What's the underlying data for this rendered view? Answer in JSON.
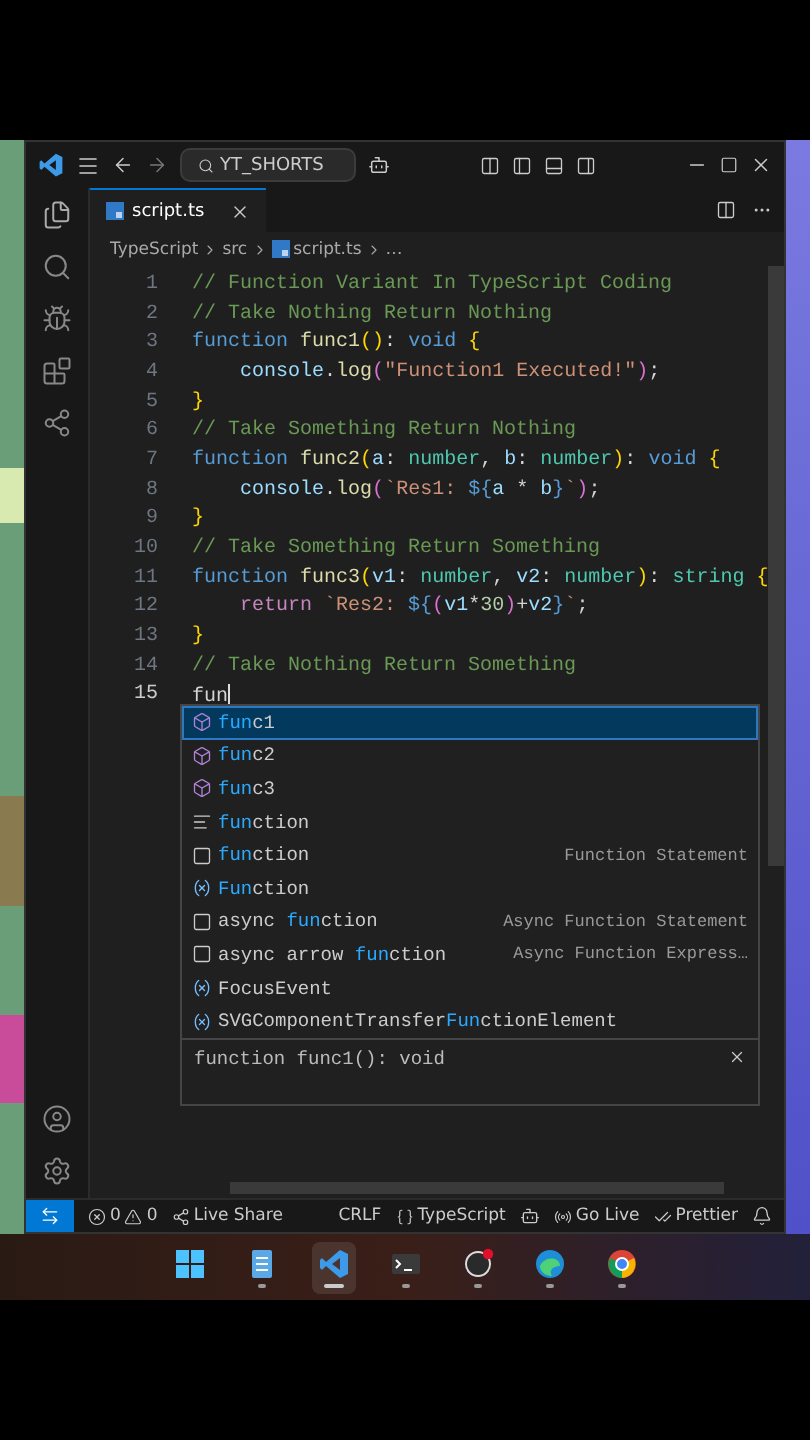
{
  "title_bar": {
    "search": "YT_SHORTS"
  },
  "tabs": [
    {
      "label": "script.ts",
      "selected": true
    }
  ],
  "breadcrumb": [
    "TypeScript",
    "src",
    "script.ts",
    "…"
  ],
  "code_lines": [
    {
      "number": "1",
      "indented": false,
      "current": false,
      "tokens": [
        {
          "kind": "comment",
          "text": "// Function Variant In TypeScript Coding"
        }
      ]
    },
    {
      "number": "2",
      "indented": false,
      "current": false,
      "tokens": [
        {
          "kind": "comment",
          "text": "// Take Nothing Return Nothing"
        }
      ]
    },
    {
      "number": "3",
      "indented": false,
      "current": false,
      "tokens": [
        {
          "kind": "keyword",
          "text": "function "
        },
        {
          "kind": "fn",
          "text": "func1"
        },
        {
          "kind": "brace",
          "text": "()"
        },
        {
          "kind": "plain",
          "text": ": "
        },
        {
          "kind": "keyword",
          "text": "void "
        },
        {
          "kind": "brace",
          "text": "{"
        }
      ]
    },
    {
      "number": "4",
      "indented": true,
      "current": false,
      "tokens": [
        {
          "kind": "param",
          "text": "console"
        },
        {
          "kind": "plain",
          "text": "."
        },
        {
          "kind": "fn",
          "text": "log"
        },
        {
          "kind": "bracket",
          "text": "("
        },
        {
          "kind": "string",
          "text": "\"Function1 Executed!\""
        },
        {
          "kind": "bracket",
          "text": ")"
        },
        {
          "kind": "plain",
          "text": ";"
        }
      ]
    },
    {
      "number": "5",
      "indented": false,
      "current": false,
      "tokens": [
        {
          "kind": "brace",
          "text": "}"
        }
      ]
    },
    {
      "number": "6",
      "indented": false,
      "current": false,
      "tokens": [
        {
          "kind": "comment",
          "text": "// Take Something Return Nothing"
        }
      ]
    },
    {
      "number": "7",
      "indented": false,
      "current": false,
      "tokens": [
        {
          "kind": "keyword",
          "text": "function "
        },
        {
          "kind": "fn",
          "text": "func2"
        },
        {
          "kind": "brace",
          "text": "("
        },
        {
          "kind": "param",
          "text": "a"
        },
        {
          "kind": "plain",
          "text": ": "
        },
        {
          "kind": "type",
          "text": "number"
        },
        {
          "kind": "plain",
          "text": ", "
        },
        {
          "kind": "param",
          "text": "b"
        },
        {
          "kind": "plain",
          "text": ": "
        },
        {
          "kind": "type",
          "text": "number"
        },
        {
          "kind": "brace",
          "text": ")"
        },
        {
          "kind": "plain",
          "text": ": "
        },
        {
          "kind": "keyword",
          "text": "void "
        },
        {
          "kind": "brace",
          "text": "{"
        }
      ]
    },
    {
      "number": "8",
      "indented": true,
      "current": false,
      "tokens": [
        {
          "kind": "param",
          "text": "console"
        },
        {
          "kind": "plain",
          "text": "."
        },
        {
          "kind": "fn",
          "text": "log"
        },
        {
          "kind": "bracket",
          "text": "("
        },
        {
          "kind": "string",
          "text": "`Res1: "
        },
        {
          "kind": "keyword",
          "text": "${"
        },
        {
          "kind": "param",
          "text": "a"
        },
        {
          "kind": "plain",
          "text": " * "
        },
        {
          "kind": "param",
          "text": "b"
        },
        {
          "kind": "keyword",
          "text": "}"
        },
        {
          "kind": "string",
          "text": "`"
        },
        {
          "kind": "bracket",
          "text": ")"
        },
        {
          "kind": "plain",
          "text": ";"
        }
      ]
    },
    {
      "number": "9",
      "indented": false,
      "current": false,
      "tokens": [
        {
          "kind": "brace",
          "text": "}"
        }
      ]
    },
    {
      "number": "10",
      "indented": false,
      "current": false,
      "tokens": [
        {
          "kind": "comment",
          "text": "// Take Something Return Something"
        }
      ]
    },
    {
      "number": "11",
      "indented": false,
      "current": false,
      "tokens": [
        {
          "kind": "keyword",
          "text": "function "
        },
        {
          "kind": "fn",
          "text": "func3"
        },
        {
          "kind": "brace",
          "text": "("
        },
        {
          "kind": "param",
          "text": "v1"
        },
        {
          "kind": "plain",
          "text": ": "
        },
        {
          "kind": "type",
          "text": "number"
        },
        {
          "kind": "plain",
          "text": ", "
        },
        {
          "kind": "param",
          "text": "v2"
        },
        {
          "kind": "plain",
          "text": ": "
        },
        {
          "kind": "type",
          "text": "number"
        },
        {
          "kind": "brace",
          "text": ")"
        },
        {
          "kind": "plain",
          "text": ": "
        },
        {
          "kind": "type",
          "text": "string "
        },
        {
          "kind": "brace",
          "text": "{"
        }
      ]
    },
    {
      "number": "12",
      "indented": true,
      "current": false,
      "tokens": [
        {
          "kind": "control",
          "text": "return "
        },
        {
          "kind": "string",
          "text": "`Res2: "
        },
        {
          "kind": "keyword",
          "text": "${"
        },
        {
          "kind": "bracket",
          "text": "("
        },
        {
          "kind": "param",
          "text": "v1"
        },
        {
          "kind": "plain",
          "text": "*"
        },
        {
          "kind": "number",
          "text": "30"
        },
        {
          "kind": "bracket",
          "text": ")"
        },
        {
          "kind": "plain",
          "text": "+"
        },
        {
          "kind": "param",
          "text": "v2"
        },
        {
          "kind": "keyword",
          "text": "}"
        },
        {
          "kind": "string",
          "text": "`"
        },
        {
          "kind": "plain",
          "text": ";"
        }
      ]
    },
    {
      "number": "13",
      "indented": false,
      "current": false,
      "tokens": [
        {
          "kind": "brace",
          "text": "}"
        }
      ]
    },
    {
      "number": "14",
      "indented": false,
      "current": false,
      "tokens": [
        {
          "kind": "comment",
          "text": "// Take Nothing Return Something"
        }
      ]
    },
    {
      "number": "15",
      "indented": false,
      "current": true,
      "tokens": [
        {
          "kind": "plain",
          "text": "fun"
        }
      ]
    }
  ],
  "suggestions": {
    "items": [
      {
        "kind": "method",
        "selected": true,
        "parts": [
          {
            "text": "fun",
            "match": true
          },
          {
            "text": "c1",
            "match": false
          }
        ]
      },
      {
        "kind": "method",
        "selected": false,
        "parts": [
          {
            "text": "fun",
            "match": true
          },
          {
            "text": "c2",
            "match": false
          }
        ]
      },
      {
        "kind": "method",
        "selected": false,
        "parts": [
          {
            "text": "fun",
            "match": true
          },
          {
            "text": "c3",
            "match": false
          }
        ]
      },
      {
        "kind": "keyword",
        "selected": false,
        "parts": [
          {
            "text": "fun",
            "match": true
          },
          {
            "text": "ction",
            "match": false
          }
        ]
      },
      {
        "kind": "snippet",
        "selected": false,
        "parts": [
          {
            "text": "fun",
            "match": true
          },
          {
            "text": "ction",
            "match": false
          }
        ],
        "detail": "Function Statement"
      },
      {
        "kind": "variable",
        "selected": false,
        "parts": [
          {
            "text": "Fun",
            "match": true
          },
          {
            "text": "ction",
            "match": false
          }
        ]
      },
      {
        "kind": "snippet",
        "selected": false,
        "parts": [
          {
            "text": "async ",
            "match": false
          },
          {
            "text": "fun",
            "match": true
          },
          {
            "text": "ction",
            "match": false
          }
        ],
        "detail": "Async Function Statement"
      },
      {
        "kind": "snippet",
        "selected": false,
        "parts": [
          {
            "text": "async arrow ",
            "match": false
          },
          {
            "text": "fun",
            "match": true
          },
          {
            "text": "ction",
            "match": false
          }
        ],
        "detail": "Async Function Express…"
      },
      {
        "kind": "variable",
        "selected": false,
        "parts": [
          {
            "text": "FocusEvent",
            "match": false
          }
        ]
      },
      {
        "kind": "variable",
        "selected": false,
        "parts": [
          {
            "text": "SVGComponentTransfer",
            "match": false
          },
          {
            "text": "Fun",
            "match": true
          },
          {
            "text": "ctionElement",
            "match": false
          }
        ]
      }
    ],
    "details": "function func1(): void"
  },
  "status_bar": {
    "errors": "0",
    "warnings": "0",
    "live_share": "Live Share",
    "line_ending": "CRLF",
    "language": "TypeScript",
    "go_live": "Go Live",
    "prettier": "Prettier"
  },
  "taskbar": {
    "apps": [
      {
        "kind": "start",
        "selected": false,
        "open": false
      },
      {
        "kind": "notepad",
        "selected": false,
        "open": true
      },
      {
        "kind": "vscode",
        "selected": true,
        "open": true
      },
      {
        "kind": "terminal",
        "selected": false,
        "open": true
      },
      {
        "kind": "obs",
        "selected": false,
        "open": true
      },
      {
        "kind": "edge",
        "selected": false,
        "open": true
      },
      {
        "kind": "chrome",
        "selected": false,
        "open": true
      }
    ]
  }
}
